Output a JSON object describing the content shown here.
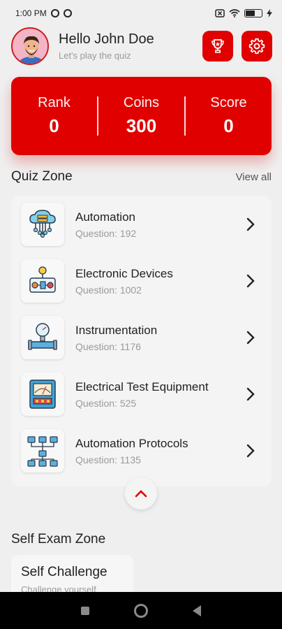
{
  "status_bar": {
    "time": "1:00 PM",
    "icons": [
      "whatsapp-icon",
      "whatsapp-icon",
      "close-box-icon",
      "wifi-icon",
      "battery-icon",
      "charging-icon"
    ]
  },
  "header": {
    "greeting": "Hello John Doe",
    "subtitle": "Let's play the quiz",
    "icons": [
      "avatar",
      "trophy-icon",
      "gear-icon"
    ]
  },
  "stats": {
    "rank_label": "Rank",
    "rank_value": "0",
    "coins_label": "Coins",
    "coins_value": "300",
    "score_label": "Score",
    "score_value": "0"
  },
  "quiz_zone": {
    "title": "Quiz Zone",
    "view_all": "View all",
    "items": [
      {
        "title": "Automation",
        "count": "Question: 192",
        "icon": "cloud-server-icon"
      },
      {
        "title": "Electronic Devices",
        "count": "Question: 1002",
        "icon": "electronic-circuit-icon"
      },
      {
        "title": "Instrumentation",
        "count": "Question: 1176",
        "icon": "pressure-gauge-icon"
      },
      {
        "title": "Electrical Test Equipment",
        "count": "Question: 525",
        "icon": "meter-icon"
      },
      {
        "title": "Automation Protocols",
        "count": "Question: 1135",
        "icon": "network-icon"
      }
    ]
  },
  "self_exam": {
    "title": "Self Exam Zone",
    "card_title": "Self Challenge",
    "card_sub": "Challenge yourself"
  },
  "colors": {
    "accent": "#e00000",
    "background": "#efefef",
    "card": "#f4f4f4",
    "text_muted": "#9a9a9a"
  }
}
